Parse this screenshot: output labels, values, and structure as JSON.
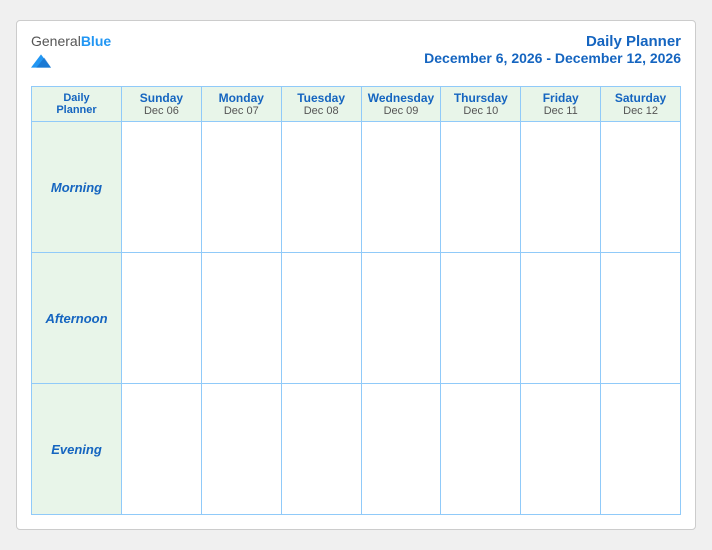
{
  "header": {
    "logo": {
      "general": "General",
      "blue": "Blue"
    },
    "title": "Daily Planner",
    "date_range": "December 6, 2026 - December 12, 2026"
  },
  "grid": {
    "header_label_line1": "Daily",
    "header_label_line2": "Planner",
    "days": [
      {
        "name": "Sunday",
        "date": "Dec 06"
      },
      {
        "name": "Monday",
        "date": "Dec 07"
      },
      {
        "name": "Tuesday",
        "date": "Dec 08"
      },
      {
        "name": "Wednesday",
        "date": "Dec 09"
      },
      {
        "name": "Thursday",
        "date": "Dec 10"
      },
      {
        "name": "Friday",
        "date": "Dec 11"
      },
      {
        "name": "Saturday",
        "date": "Dec 12"
      }
    ],
    "rows": [
      {
        "label": "Morning"
      },
      {
        "label": "Afternoon"
      },
      {
        "label": "Evening"
      }
    ]
  }
}
